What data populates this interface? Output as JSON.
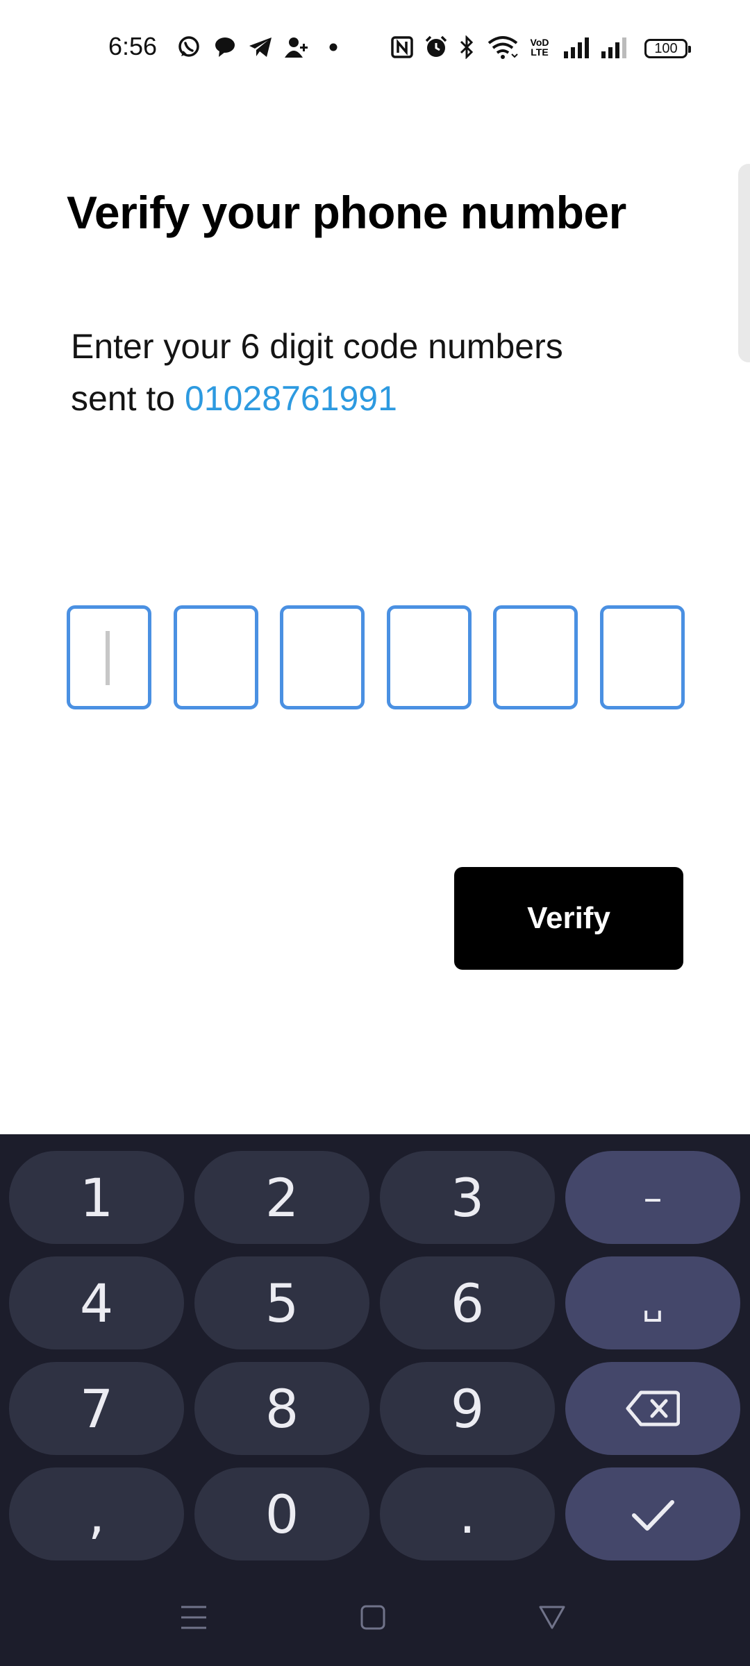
{
  "status_bar": {
    "time": "6:56",
    "battery": "100",
    "network_label": "VoD LTE",
    "icons": [
      "whatsapp-icon",
      "chat-bubble-icon",
      "telegram-icon",
      "person-add-icon",
      "dot-icon",
      "nfc-icon",
      "alarm-icon",
      "bluetooth-icon",
      "wifi-icon",
      "volte-icon",
      "signal-icon",
      "signal-icon",
      "battery-icon"
    ]
  },
  "screen": {
    "title": "Verify your phone number",
    "subtitle_line1": "Enter your 6 digit code numbers",
    "subtitle_prefix": "sent to ",
    "phone_number": "01028761991"
  },
  "otp": {
    "digit_count": 6,
    "values": [
      "",
      "",
      "",
      "",
      "",
      ""
    ],
    "focused_index": 0
  },
  "verify_button": {
    "label": "Verify"
  },
  "keyboard": {
    "rows": [
      [
        "1",
        "2",
        "3",
        "–"
      ],
      [
        "4",
        "5",
        "6",
        "␣"
      ],
      [
        "7",
        "8",
        "9",
        "backspace-icon"
      ],
      [
        ",",
        "0",
        ".",
        "check-icon"
      ]
    ]
  },
  "navigation_bar": [
    "menu-icon",
    "home-icon",
    "back-icon"
  ],
  "colors": {
    "accent_blue": "#4a90e2",
    "phone_link": "#2d9ae0",
    "button_bg": "#000000",
    "keyboard_bg": "#1c1d2b",
    "key_bg": "#2f3243",
    "key_fn_bg": "#44476a"
  }
}
